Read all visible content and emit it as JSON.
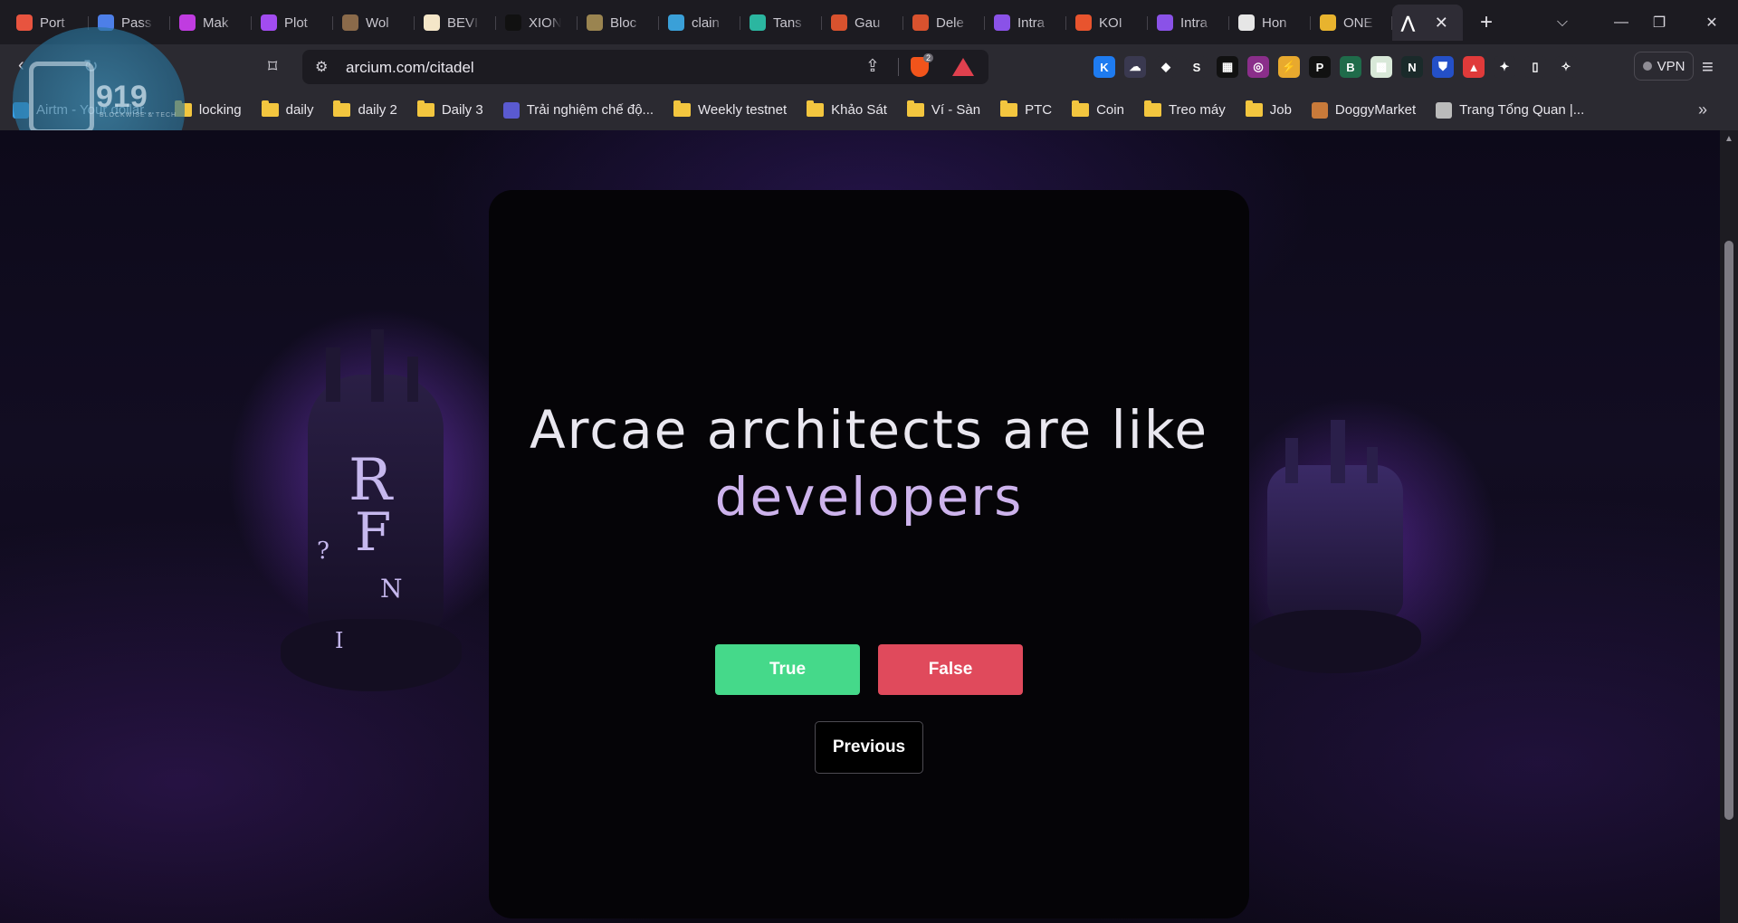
{
  "browser": {
    "tabs": [
      {
        "title": "Port",
        "color": "#e8543f"
      },
      {
        "title": "Pass",
        "color": "#4d7fe8"
      },
      {
        "title": "Mak",
        "color": "#c03ce0"
      },
      {
        "title": "Plot",
        "color": "#a24cf0"
      },
      {
        "title": "Wol",
        "color": "#8a6a4a"
      },
      {
        "title": "BEVI",
        "color": "#f4e6c8"
      },
      {
        "title": "XION",
        "color": "#111111"
      },
      {
        "title": "Bloc",
        "color": "#9a8450"
      },
      {
        "title": "clain",
        "color": "#3aa0d8"
      },
      {
        "title": "Tans",
        "color": "#2bb6a0"
      },
      {
        "title": "Gau",
        "color": "#d8522e"
      },
      {
        "title": "Dele",
        "color": "#d8522e"
      },
      {
        "title": "Intra",
        "color": "#8a52e8"
      },
      {
        "title": "KOI",
        "color": "#e8542e"
      },
      {
        "title": "Intra",
        "color": "#8a52e8"
      },
      {
        "title": "Hon",
        "color": "#e6e6e6"
      },
      {
        "title": "ONE",
        "color": "#e8b32e"
      }
    ],
    "active_tab_icon": "arcium-logo-icon",
    "url": "arcium.com/citadel",
    "brave_badge": "2",
    "vpn_label": "VPN",
    "extensions": [
      {
        "name": "k-extension-icon",
        "glyph": "K",
        "color": "#1e7bf0"
      },
      {
        "name": "cloud-extension-icon",
        "glyph": "☁",
        "color": "#3a3950"
      },
      {
        "name": "diamond-extension-icon",
        "glyph": "◆",
        "color": "#2b2a31"
      },
      {
        "name": "s-extension-icon",
        "glyph": "S",
        "color": "#2b2a31"
      },
      {
        "name": "okx-extension-icon",
        "glyph": "▦",
        "color": "#111111"
      },
      {
        "name": "circle-extension-icon",
        "glyph": "◎",
        "color": "#8a2e8a"
      },
      {
        "name": "bolt-extension-icon",
        "glyph": "⚡",
        "color": "#e8a92e"
      },
      {
        "name": "p-extension-icon",
        "glyph": "P",
        "color": "#111111"
      },
      {
        "name": "b-extension-icon",
        "glyph": "B",
        "color": "#1f6b4a"
      },
      {
        "name": "grid-extension-icon",
        "glyph": "▩",
        "color": "#d8e8d8"
      },
      {
        "name": "n-extension-icon",
        "glyph": "N",
        "color": "#1a2a2a"
      },
      {
        "name": "shield-extension-icon",
        "glyph": "⛊",
        "color": "#2450c8"
      },
      {
        "name": "lock-extension-icon",
        "glyph": "▲",
        "color": "#e03a3a"
      },
      {
        "name": "puzzle-icon",
        "glyph": "✦",
        "color": "#2b2a31"
      },
      {
        "name": "sidebar-icon",
        "glyph": "▯",
        "color": "#2b2a31"
      },
      {
        "name": "leo-icon",
        "glyph": "✧",
        "color": "#2b2a31"
      }
    ],
    "bookmarks": [
      {
        "label": "Airtm - Your dollar...",
        "type": "site",
        "color": "#3aa0e8"
      },
      {
        "label": "locking",
        "type": "folder"
      },
      {
        "label": "daily",
        "type": "folder"
      },
      {
        "label": "daily 2",
        "type": "folder"
      },
      {
        "label": "Daily 3",
        "type": "folder"
      },
      {
        "label": "Trải nghiệm chế độ...",
        "type": "site",
        "color": "#5a5ad0"
      },
      {
        "label": "Weekly testnet",
        "type": "folder"
      },
      {
        "label": "Khảo Sát",
        "type": "folder"
      },
      {
        "label": "Ví - Sàn",
        "type": "folder"
      },
      {
        "label": "PTC",
        "type": "folder"
      },
      {
        "label": "Coin",
        "type": "folder"
      },
      {
        "label": "Treo máy",
        "type": "folder"
      },
      {
        "label": "Job",
        "type": "folder"
      },
      {
        "label": "DoggyMarket",
        "type": "site",
        "color": "#c87a3a"
      },
      {
        "label": "Trang Tổng Quan |...",
        "type": "site",
        "color": "#bbbbbb"
      }
    ]
  },
  "watermark": {
    "number": "919",
    "tagline": "BLOCKWISE & TECH"
  },
  "quiz": {
    "question_main": "Arcae architects are like",
    "question_accent": "developers",
    "true_label": "True",
    "false_label": "False",
    "previous_label": "Previous"
  },
  "colors": {
    "true_button": "#45d98a",
    "false_button": "#e04a5c",
    "accent_text": "#cdb3ec"
  }
}
